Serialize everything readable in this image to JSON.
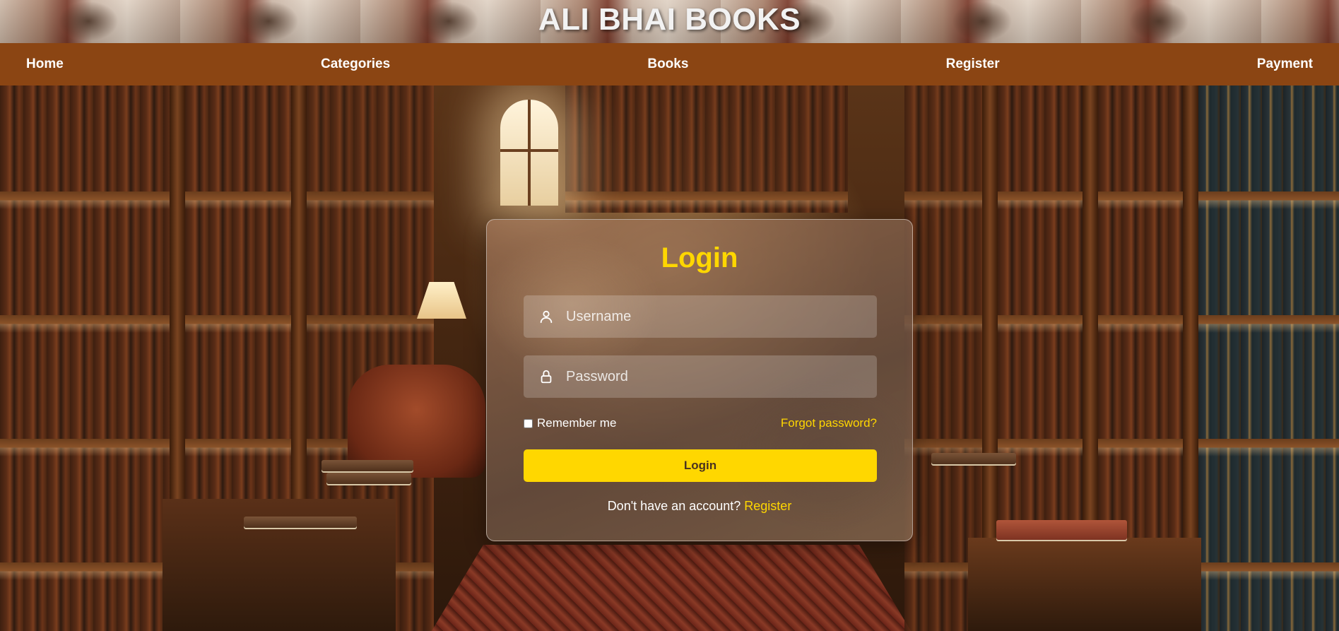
{
  "banner": {
    "title": "ALI BHAI BOOKS"
  },
  "nav": {
    "items": [
      {
        "label": "Home"
      },
      {
        "label": "Categories"
      },
      {
        "label": "Books"
      },
      {
        "label": "Register"
      },
      {
        "label": "Payment"
      }
    ]
  },
  "login": {
    "title": "Login",
    "username_placeholder": "Username",
    "username_icon": "user-icon",
    "password_placeholder": "Password",
    "password_icon": "lock-icon",
    "remember_label": "Remember me",
    "remember_checked": false,
    "forgot_label": "Forgot password?",
    "submit_label": "Login",
    "signup_prompt": "Don't have an account?",
    "signup_link": "Register"
  },
  "colors": {
    "nav_bg": "#8b4513",
    "accent": "#ffd700",
    "text": "#ffffff"
  }
}
